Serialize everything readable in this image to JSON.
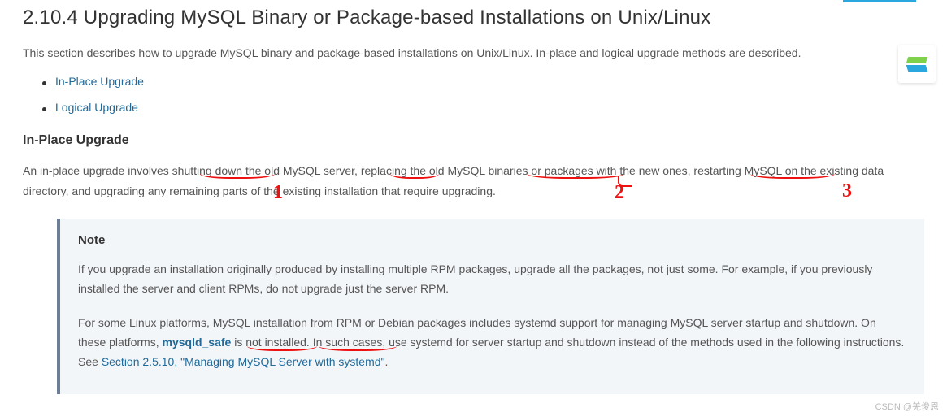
{
  "title": "2.10.4 Upgrading MySQL Binary or Package-based Installations on Unix/Linux",
  "intro": "This section describes how to upgrade MySQL binary and package-based installations on Unix/Linux. In-place and logical upgrade methods are described.",
  "toc": {
    "items": [
      {
        "label": "In-Place Upgrade"
      },
      {
        "label": "Logical Upgrade"
      }
    ]
  },
  "section": {
    "heading": "In-Place Upgrade",
    "body": "An in-place upgrade involves shutting down the old MySQL server, replacing the old MySQL binaries or packages with the new ones, restarting MySQL on the existing data directory, and upgrading any remaining parts of the existing installation that require upgrading."
  },
  "note": {
    "title": "Note",
    "p1": "If you upgrade an installation originally produced by installing multiple RPM packages, upgrade all the packages, not just some. For example, if you previously installed the server and client RPMs, do not upgrade just the server RPM.",
    "p2_a": "For some Linux platforms, MySQL installation from RPM or Debian packages includes systemd support for managing MySQL server startup and shutdown. On these platforms, ",
    "p2_kw": "mysqld_safe",
    "p2_b": " is not installed. In such cases, use systemd for server startup and shutdown instead of the methods used in the following instructions. See ",
    "p2_link": "Section 2.5.10, \"Managing MySQL Server with systemd\"",
    "p2_c": "."
  },
  "annotations": {
    "num1": "1",
    "num2": "2",
    "num3": "3"
  },
  "watermark": "CSDN @羌俊恩"
}
